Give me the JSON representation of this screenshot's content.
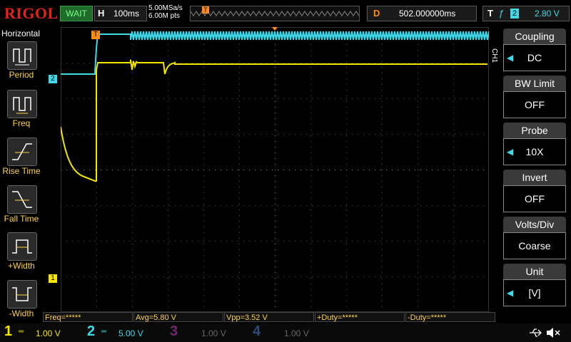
{
  "brand": "RIGOL",
  "run_state": "WAIT",
  "horizontal": {
    "label": "H",
    "timebase": "100ms",
    "sample_rate": "5.00MSa/s",
    "memory_depth": "6.00M pts"
  },
  "trigger_marker": "T",
  "delay": {
    "label": "D",
    "value": "502.000000ms"
  },
  "trigger": {
    "label": "T",
    "edge_symbol": "ƒ",
    "channel": "2",
    "level": "2.80 V"
  },
  "left_menu": {
    "title": "Horizontal",
    "items": [
      {
        "label": "Period"
      },
      {
        "label": "Freq"
      },
      {
        "label": "Rise Time"
      },
      {
        "label": "Fall Time"
      },
      {
        "label": "+Width"
      },
      {
        "label": "-Width"
      }
    ]
  },
  "right_menu": {
    "channel_tag": "CH1",
    "items": [
      {
        "title": "Coupling",
        "value": "DC"
      },
      {
        "title": "BW Limit",
        "value": "OFF"
      },
      {
        "title": "Probe",
        "value": "10X"
      },
      {
        "title": "Invert",
        "value": "OFF"
      },
      {
        "title": "Volts/Div",
        "value": "Coarse"
      },
      {
        "title": "Unit",
        "value": "[V]"
      }
    ]
  },
  "markers": {
    "ch1": "1",
    "ch2": "2"
  },
  "measurements": [
    "Freq=*****",
    "Avg=5.80 V",
    "Vpp=3.52 V",
    "+Duty=*****",
    "-Duty=*****"
  ],
  "channels": [
    {
      "num": "1",
      "scale": "1.00 V",
      "color": "#f5e500"
    },
    {
      "num": "2",
      "scale": "5.00 V",
      "color": "#3fd9e8"
    },
    {
      "num": "3",
      "scale": "1.00 V",
      "color": "#c83cc8"
    },
    {
      "num": "4",
      "scale": "1.00 V",
      "color": "#2a7ff0"
    }
  ],
  "colors": {
    "ch1": "#f5e500",
    "ch2": "#3fd9e8",
    "grid": "#3a3a3a",
    "trigger": "#ff8c1a"
  }
}
